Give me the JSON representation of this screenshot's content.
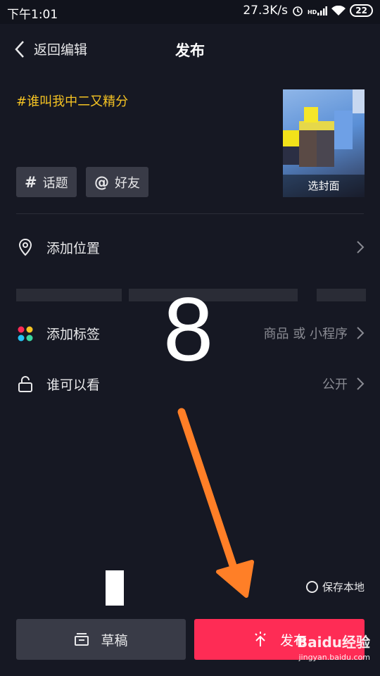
{
  "status_bar": {
    "time": "下午1:01",
    "network_speed": "27.3K/s",
    "signal_label": "HD",
    "battery": "22"
  },
  "nav": {
    "back_label": "返回编辑",
    "title": "发布"
  },
  "post": {
    "caption": "#谁叫我中二又精分",
    "cover_label": "选封面"
  },
  "tag_buttons": {
    "topic_symbol": "#",
    "topic_label": "话题",
    "friend_symbol": "@",
    "friend_label": "好友"
  },
  "settings": {
    "location": {
      "label": "添加位置",
      "value": ""
    },
    "tags": {
      "label": "添加标签",
      "value": "商品 或 小程序"
    },
    "visibility": {
      "label": "谁可以看",
      "value": "公开"
    }
  },
  "overlay": {
    "step_number": "8",
    "arrow_color": "#ff7f27"
  },
  "bottom": {
    "save_local_label": "保存本地",
    "draft_label": "草稿",
    "publish_label": "发布"
  },
  "watermark": {
    "brand": "Baidu经验",
    "url": "jingyan.baidu.com"
  },
  "colors": {
    "background": "#161823",
    "accent_publish": "#fe2c55",
    "caption_yellow": "#f5c323",
    "button_gray": "#393b47"
  }
}
